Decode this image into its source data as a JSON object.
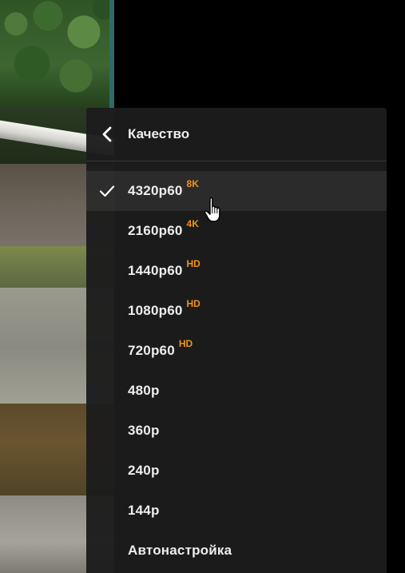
{
  "quality_menu": {
    "title": "Качество",
    "back_icon": "chevron-left-icon",
    "selected_icon": "check-icon",
    "items": [
      {
        "label": "4320p60",
        "badge": "8K",
        "selected": true
      },
      {
        "label": "2160p60",
        "badge": "4K",
        "selected": false
      },
      {
        "label": "1440p60",
        "badge": "HD",
        "selected": false
      },
      {
        "label": "1080p60",
        "badge": "HD",
        "selected": false
      },
      {
        "label": "720p60",
        "badge": "HD",
        "selected": false
      },
      {
        "label": "480p",
        "badge": "",
        "selected": false
      },
      {
        "label": "360p",
        "badge": "",
        "selected": false
      },
      {
        "label": "240p",
        "badge": "",
        "selected": false
      },
      {
        "label": "144p",
        "badge": "",
        "selected": false
      },
      {
        "label": "Автонастройка",
        "badge": "",
        "selected": false
      }
    ]
  },
  "colors": {
    "badge": "#f29318",
    "menu_background": "#1c1c1c",
    "text": "#eeeeee"
  },
  "cursor_icon": "hand-pointer-icon"
}
